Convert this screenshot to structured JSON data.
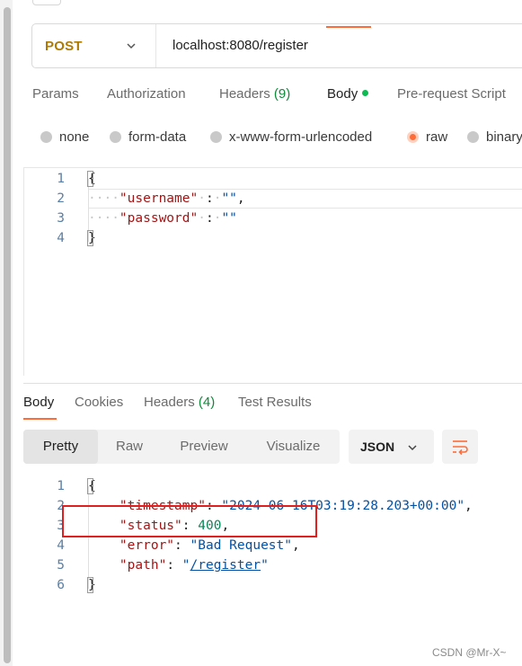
{
  "request": {
    "method": "POST",
    "url": "localhost:8080/register",
    "tabs": [
      {
        "label": "Params"
      },
      {
        "label": "Authorization"
      },
      {
        "label": "Headers",
        "count": "(9)"
      },
      {
        "label": "Body",
        "active": true
      },
      {
        "label": "Pre-request Script"
      }
    ],
    "body_types": [
      "none",
      "form-data",
      "x-www-form-urlencoded",
      "raw",
      "binary"
    ],
    "body_type_selected": "raw",
    "code_lines": [
      {
        "n": "1",
        "text": "{"
      },
      {
        "n": "2",
        "key": "\"username\"",
        "sep": " : ",
        "value": "\"\"",
        "trail": ","
      },
      {
        "n": "3",
        "key": "\"password\"",
        "sep": " : ",
        "value": "\"\"",
        "trail": ""
      },
      {
        "n": "4",
        "text": "}"
      }
    ]
  },
  "response": {
    "tabs": [
      {
        "label": "Body",
        "active": true
      },
      {
        "label": "Cookies"
      },
      {
        "label": "Headers",
        "count": "(4)"
      },
      {
        "label": "Test Results"
      }
    ],
    "views": [
      "Pretty",
      "Raw",
      "Preview",
      "Visualize"
    ],
    "view_selected": "Pretty",
    "format": "JSON",
    "code_lines": [
      {
        "n": "1",
        "text": "{"
      },
      {
        "n": "2",
        "key": "\"timestamp\"",
        "value": "\"2024-06-16T03:19:28.203+00:00\"",
        "trail": ","
      },
      {
        "n": "3",
        "key": "\"status\"",
        "value": "400",
        "trail": ","
      },
      {
        "n": "4",
        "key": "\"error\"",
        "value": "\"Bad Request\"",
        "trail": ","
      },
      {
        "n": "5",
        "key": "\"path\"",
        "value_q1": "\"",
        "value_link": "/register",
        "value_q2": "\"",
        "trail": ""
      },
      {
        "n": "6",
        "text": "}"
      }
    ]
  },
  "icons": {
    "method_chevron": "chevron-down-icon",
    "json_chevron": "chevron-down-icon",
    "wrap": "wrap-lines-icon"
  },
  "colors": {
    "method": "#ad7a03",
    "accent": "#ff6c37",
    "body_dot": "#0cbb52",
    "json_key": "#a31515",
    "json_string": "#0451a5",
    "json_number": "#098658",
    "highlight_box": "#e02020"
  },
  "watermark": "CSDN @Mr-X~"
}
